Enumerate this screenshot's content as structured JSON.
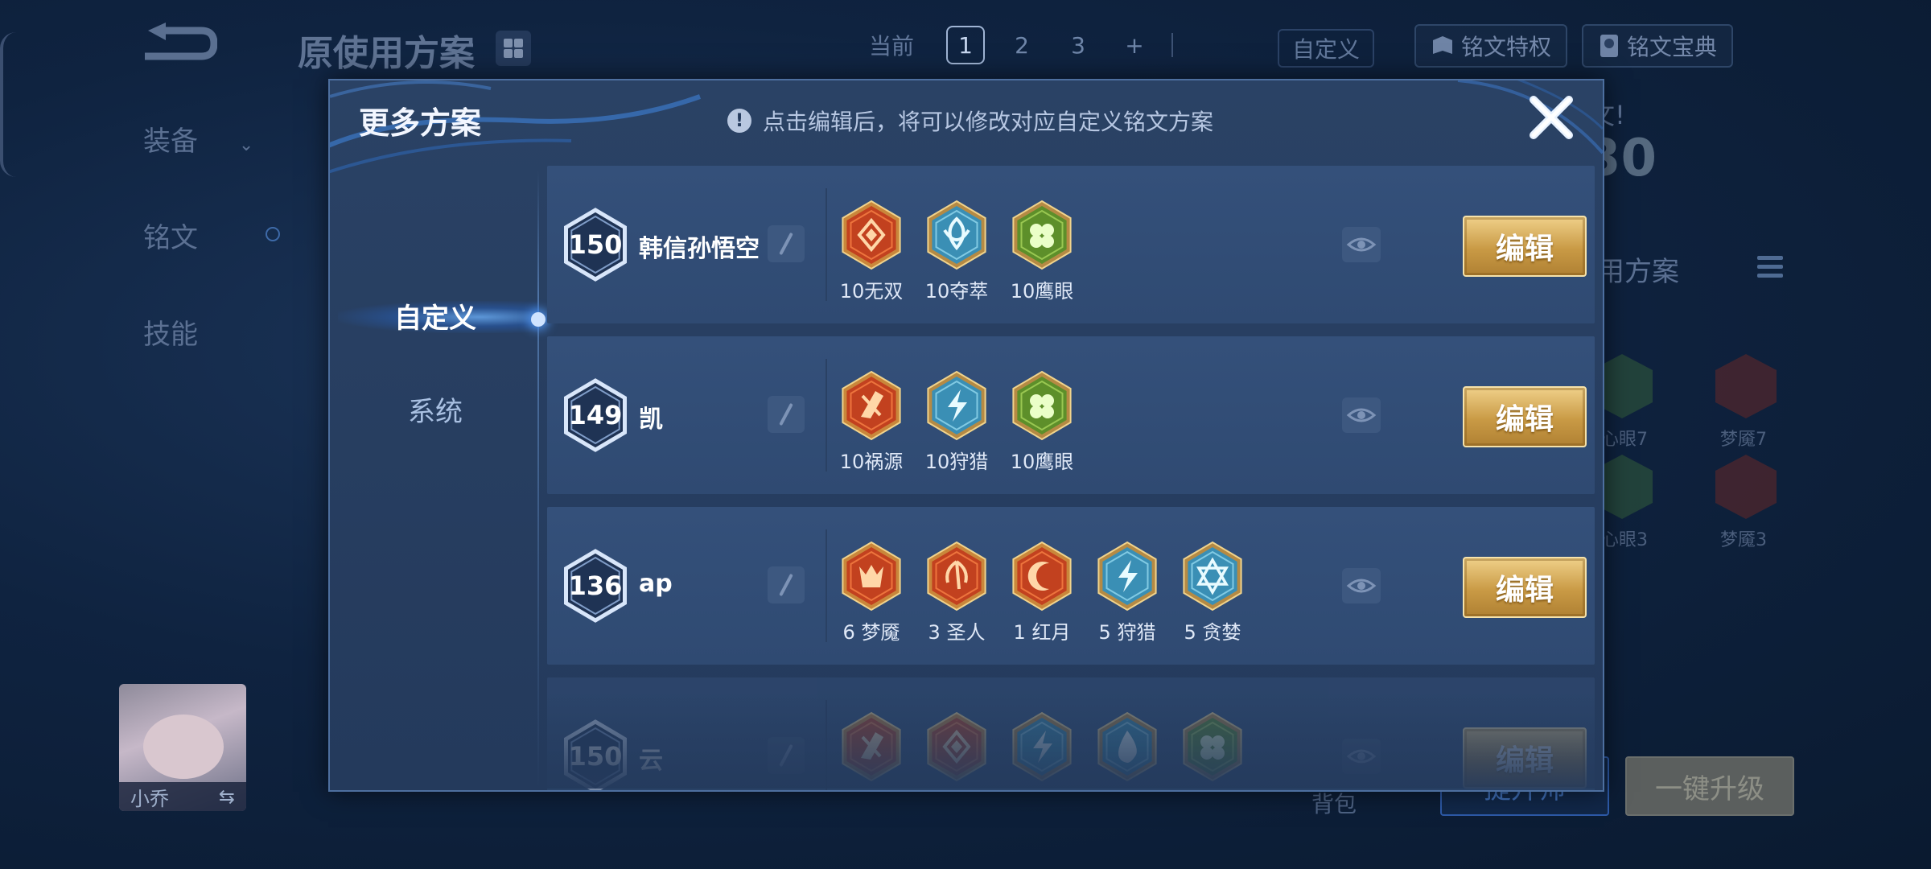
{
  "background": {
    "title": "原使用方案",
    "pages": {
      "current_label": "当前",
      "items": [
        "1",
        "2",
        "3",
        "+"
      ],
      "active": "1"
    },
    "custom_label": "自定义",
    "rune_privilege": "铭文特权",
    "rune_codex": "铭文宝典",
    "nav": {
      "equipment": "装备",
      "rune": "铭文",
      "skill": "技能"
    },
    "right_big_level": "30",
    "right_label": "用方案",
    "right_partial_text": "文!",
    "mini_runes": [
      {
        "label": "心眼7",
        "color": "#3c6b3a"
      },
      {
        "label": "梦魇7",
        "color": "#7a2b24"
      },
      {
        "label": "心眼3",
        "color": "#3c6b3a"
      },
      {
        "label": "梦魇3",
        "color": "#7a2b24"
      }
    ],
    "hero_name": "小乔",
    "swap_icon": "⇆",
    "bag": "背包",
    "bottom_buttons": {
      "left": "提升师",
      "right": "一键升级"
    }
  },
  "modal": {
    "title": "更多方案",
    "hint": "点击编辑后，将可以修改对应自定义铭文方案",
    "hint_icon": "!",
    "tabs": [
      {
        "label": "自定义",
        "active": true
      },
      {
        "label": "系统",
        "active": false
      }
    ],
    "edit_label": "编辑",
    "plans": [
      {
        "level": "150",
        "name": "韩信孙悟空",
        "runes": [
          {
            "label": "10无双",
            "type": "red",
            "icon": "diamond"
          },
          {
            "label": "10夺萃",
            "type": "blue",
            "icon": "knot"
          },
          {
            "label": "10鹰眼",
            "type": "green",
            "icon": "clover"
          }
        ]
      },
      {
        "level": "149",
        "name": "凯",
        "runes": [
          {
            "label": "10祸源",
            "type": "red",
            "icon": "shard"
          },
          {
            "label": "10狩猎",
            "type": "blue",
            "icon": "bolt"
          },
          {
            "label": "10鹰眼",
            "type": "green",
            "icon": "clover"
          }
        ]
      },
      {
        "level": "136",
        "name": "ap",
        "runes": [
          {
            "label": "6 梦魇",
            "type": "red",
            "icon": "demon"
          },
          {
            "label": "3 圣人",
            "type": "red",
            "icon": "wing"
          },
          {
            "label": "1 红月",
            "type": "red",
            "icon": "moon"
          },
          {
            "label": "5 狩猎",
            "type": "blue",
            "icon": "bolt"
          },
          {
            "label": "5 贪婪",
            "type": "blue",
            "icon": "star"
          }
        ]
      },
      {
        "level": "150",
        "name": "云",
        "runes": [
          {
            "label": "",
            "type": "red",
            "icon": "shard"
          },
          {
            "label": "",
            "type": "red",
            "icon": "diamond"
          },
          {
            "label": "",
            "type": "blue",
            "icon": "bolt"
          },
          {
            "label": "",
            "type": "blue",
            "icon": "drop"
          },
          {
            "label": "",
            "type": "green",
            "icon": "clover"
          }
        ]
      }
    ]
  }
}
